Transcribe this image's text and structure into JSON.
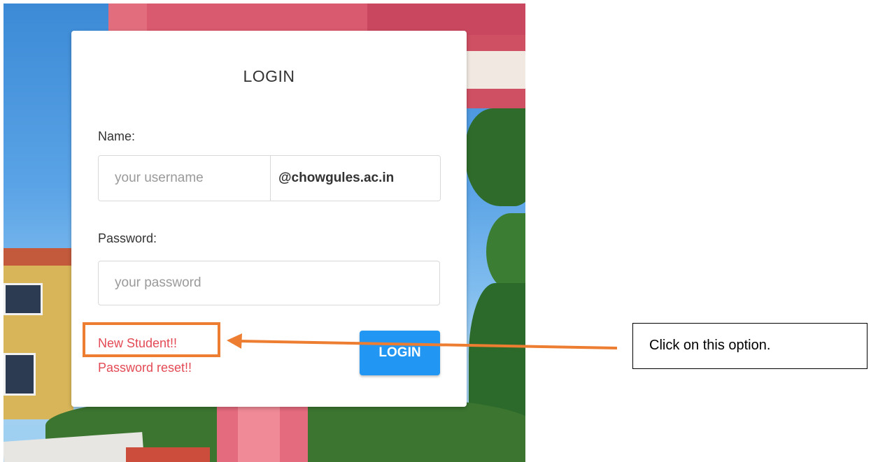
{
  "login_card": {
    "title": "LOGIN",
    "name_label": "Name:",
    "username_placeholder": "your username",
    "domain_suffix": "@chowgules.ac.in",
    "password_label": "Password:",
    "password_placeholder": "your password",
    "new_student_link": "New Student!!",
    "password_reset_link": "Password reset!!",
    "login_button": "LOGIN"
  },
  "annotation": {
    "callout_text": "Click on this option.",
    "highlight_color": "#ed7d31"
  },
  "colors": {
    "link": "#e34a55",
    "button": "#2196f3"
  }
}
